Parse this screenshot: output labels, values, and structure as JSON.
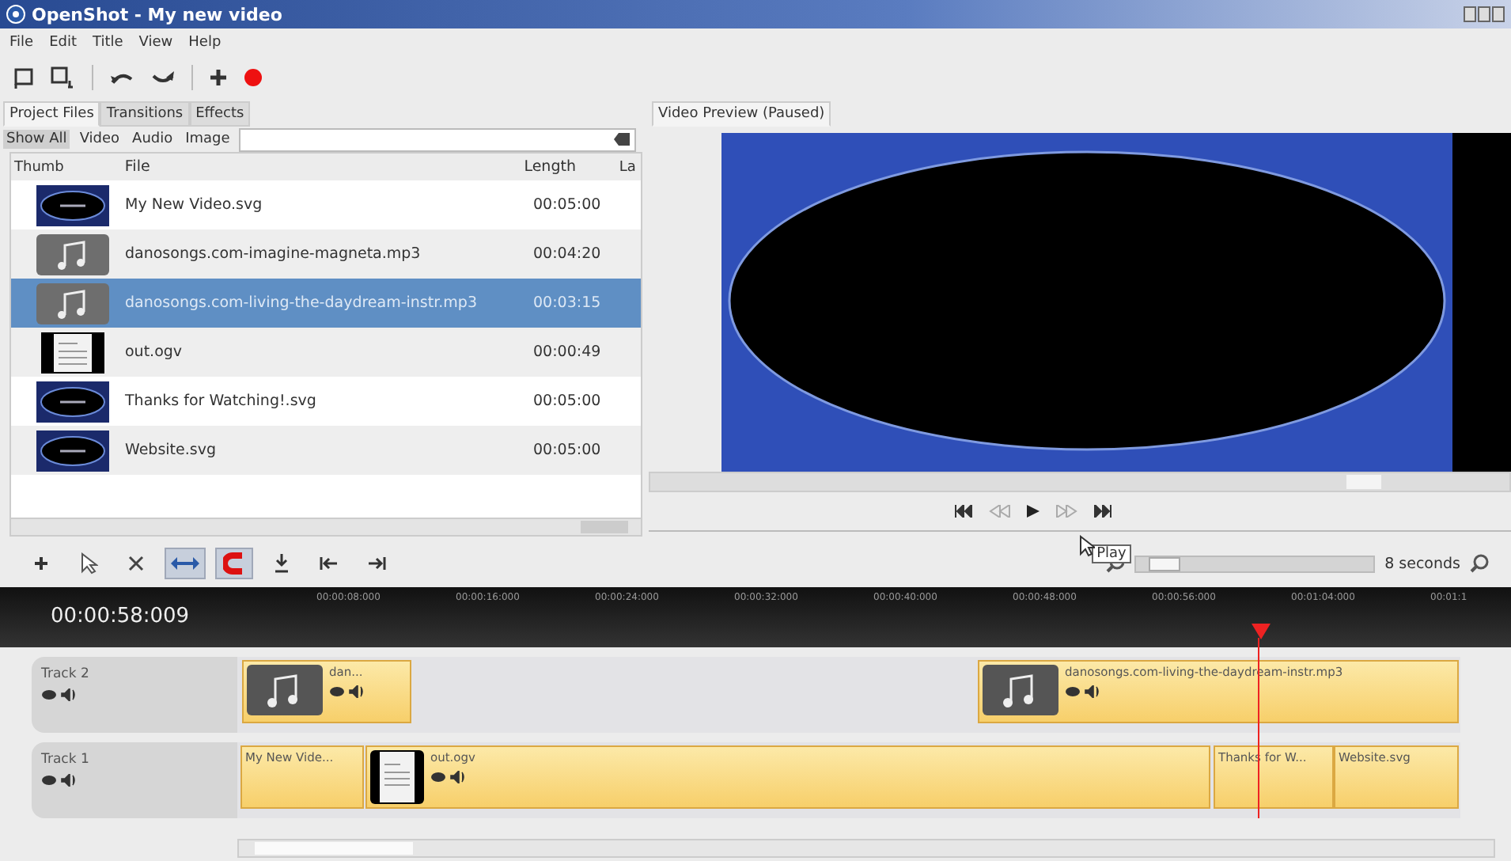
{
  "window": {
    "title": "OpenShot - My new video"
  },
  "menu": [
    "File",
    "Edit",
    "Title",
    "View",
    "Help"
  ],
  "left_tabs": [
    {
      "label": "Project Files",
      "selected": true
    },
    {
      "label": "Transitions",
      "selected": false
    },
    {
      "label": "Effects",
      "selected": false
    }
  ],
  "filters": [
    {
      "label": "Show All",
      "selected": true
    },
    {
      "label": "Video",
      "selected": false
    },
    {
      "label": "Audio",
      "selected": false
    },
    {
      "label": "Image",
      "selected": false
    }
  ],
  "table": {
    "columns": [
      "Thumb",
      "File",
      "Length",
      "La"
    ],
    "rows": [
      {
        "kind": "title",
        "file": "My New Video.svg",
        "length": "00:05:00",
        "selected": false
      },
      {
        "kind": "audio",
        "file": "danosongs.com-imagine-magneta.mp3",
        "length": "00:04:20",
        "selected": false
      },
      {
        "kind": "audio",
        "file": "danosongs.com-living-the-daydream-instr.mp3",
        "length": "00:03:15",
        "selected": true
      },
      {
        "kind": "video",
        "file": "out.ogv",
        "length": "00:00:49",
        "selected": false
      },
      {
        "kind": "title",
        "file": "Thanks for Watching!.svg",
        "length": "00:05:00",
        "selected": false
      },
      {
        "kind": "title",
        "file": "Website.svg",
        "length": "00:05:00",
        "selected": false
      }
    ]
  },
  "preview": {
    "title": "Video Preview (Paused)",
    "tooltip": "Play"
  },
  "timeline": {
    "tools": [
      {
        "kind": "add",
        "on": false
      },
      {
        "kind": "select",
        "on": false
      },
      {
        "kind": "razor",
        "on": false
      },
      {
        "kind": "resize",
        "on": true
      },
      {
        "kind": "snap",
        "on": true
      },
      {
        "kind": "marker",
        "on": false
      },
      {
        "kind": "prev",
        "on": false
      },
      {
        "kind": "next",
        "on": false
      }
    ],
    "zoom": {
      "level": 0.05,
      "label": "8 seconds"
    },
    "timecode": "00:00:58:009",
    "ticks": [
      "00:00:08:000",
      "00:00:16:000",
      "00:00:24:000",
      "00:00:32:000",
      "00:00:40:000",
      "00:00:48:000",
      "00:00:56:000",
      "00:01:04:000",
      "00:01:1"
    ],
    "tracks": [
      {
        "name": "Track 2",
        "clips": [
          {
            "label": "dan...",
            "kind": "audio"
          },
          {
            "label": "danosongs.com-living-the-daydream-instr.mp3",
            "kind": "audio"
          }
        ]
      },
      {
        "name": "Track 1",
        "clips": [
          {
            "label": "My New Vide...",
            "kind": "title"
          },
          {
            "label": "out.ogv",
            "kind": "video"
          },
          {
            "label": "Thanks for W...",
            "kind": "title"
          },
          {
            "label": "Website.svg",
            "kind": "title"
          }
        ]
      }
    ]
  }
}
